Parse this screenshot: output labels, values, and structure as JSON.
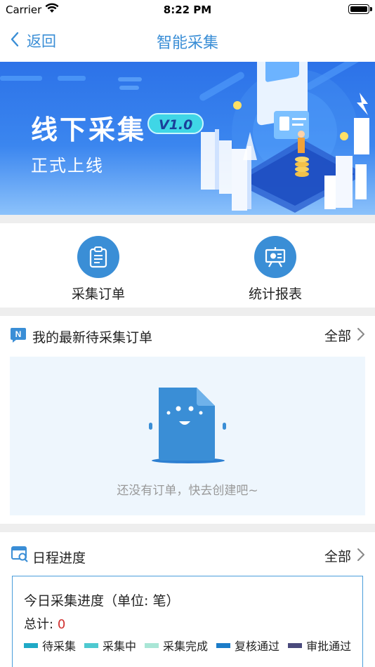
{
  "status_bar": {
    "carrier": "Carrier",
    "time": "8:22 PM"
  },
  "nav": {
    "back_label": "返回",
    "title": "智能采集"
  },
  "banner": {
    "title": "线下采集",
    "version": "V1.0",
    "subtitle": "正式上线"
  },
  "actions": [
    {
      "label": "采集订单",
      "icon": "clipboard-icon"
    },
    {
      "label": "统计报表",
      "icon": "presentation-chart-icon"
    }
  ],
  "orders": {
    "title": "我的最新待采集订单",
    "more_label": "全部",
    "empty_text": "还没有订单，快去创建吧~"
  },
  "schedule": {
    "title": "日程进度",
    "more_label": "全部",
    "card_title": "今日采集进度（单位: 笔）",
    "total_label": "总计:",
    "total_value": "0",
    "legend": [
      {
        "label": "待采集",
        "color": "#1fa9c6"
      },
      {
        "label": "采集中",
        "color": "#4ec9d0"
      },
      {
        "label": "采集完成",
        "color": "#a9e6d6"
      },
      {
        "label": "复核通过",
        "color": "#1b7cc8"
      },
      {
        "label": "审批通过",
        "color": "#4a4a7c"
      }
    ]
  },
  "colors": {
    "accent": "#3a8ed6",
    "total_value": "#d0302f"
  }
}
